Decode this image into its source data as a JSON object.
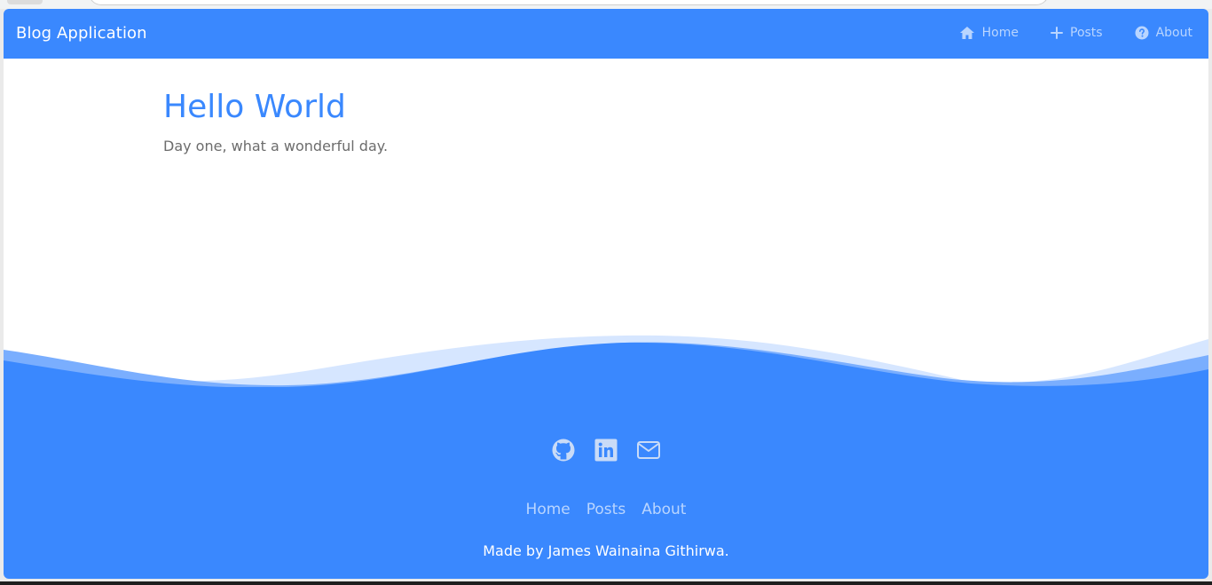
{
  "navbar": {
    "brand": "Blog Application",
    "links": [
      {
        "label": "Home",
        "icon": "home-icon"
      },
      {
        "label": "Posts",
        "icon": "plus-icon"
      },
      {
        "label": "About",
        "icon": "question-circle-icon"
      }
    ]
  },
  "post": {
    "title": "Hello World",
    "body": "Day one, what a wonderful day."
  },
  "footer": {
    "social": [
      {
        "icon": "github-icon"
      },
      {
        "icon": "linkedin-icon"
      },
      {
        "icon": "mail-icon"
      }
    ],
    "links": [
      "Home",
      "Posts",
      "About"
    ],
    "credit": "Made by James Wainaina Githirwa."
  },
  "colors": {
    "primary": "#3a88fe",
    "nav_link": "#b9d5ff",
    "body_text": "#6c6c6c"
  }
}
